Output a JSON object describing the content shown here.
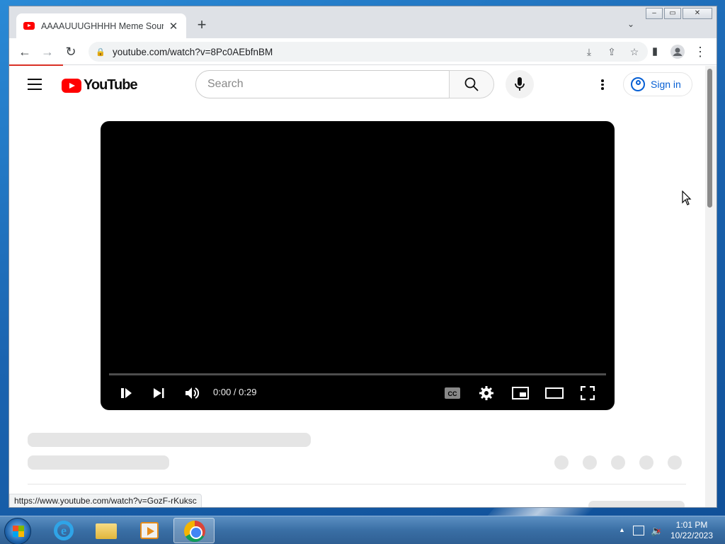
{
  "browser": {
    "tab_title": "AAAAUUUGHHHH Meme Sound",
    "url": "youtube.com/watch?v=8Pc0AEbfnBM",
    "status_url": "https://www.youtube.com/watch?v=GozF-rKuksc",
    "window_controls": [
      "minimize",
      "maximize",
      "close"
    ]
  },
  "youtube": {
    "logo_text": "YouTube",
    "search_placeholder": "Search",
    "sign_in_label": "Sign in"
  },
  "player": {
    "time": "0:00 / 0:29",
    "progress": 0
  },
  "taskbar": {
    "apps": [
      "internet-explorer",
      "file-explorer",
      "media-player",
      "chrome"
    ],
    "active_app": "chrome",
    "clock_time": "1:01 PM",
    "clock_date": "10/22/2023"
  },
  "colors": {
    "youtube_red": "#ff0000",
    "link_blue": "#065fd4",
    "player_bg": "#000000"
  }
}
